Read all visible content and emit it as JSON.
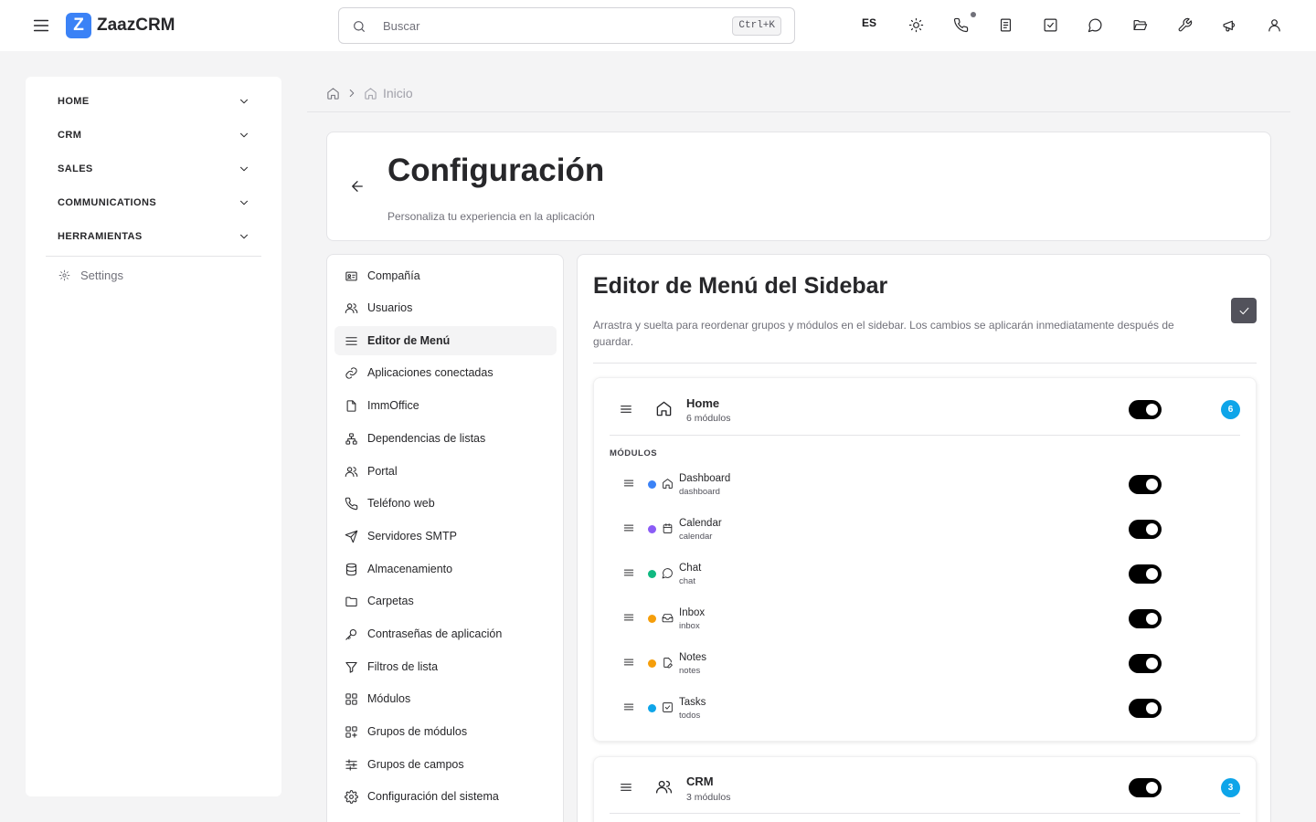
{
  "app": {
    "logo_letter": "Z",
    "name": "ZaazCRM"
  },
  "topbar": {
    "search_placeholder": "Buscar",
    "search_shortcut": "Ctrl+K",
    "language": "ES",
    "icons": [
      "sun-icon",
      "phone-icon",
      "notebook-icon",
      "check-square-icon",
      "chat-icon",
      "folder-icon",
      "wrench-icon",
      "megaphone-icon",
      "user-icon"
    ]
  },
  "leftnav": {
    "groups": [
      "HOME",
      "CRM",
      "SALES",
      "COMMUNICATIONS",
      "HERRAMIENTAS"
    ],
    "settings_label": "Settings"
  },
  "breadcrumb": {
    "current": "Inicio"
  },
  "header": {
    "title": "Configuración",
    "subtitle": "Personaliza tu experiencia en la aplicación"
  },
  "settings_nav": {
    "items": [
      {
        "label": "Compañía",
        "icon": "id-card-icon"
      },
      {
        "label": "Usuarios",
        "icon": "users-icon"
      },
      {
        "label": "Editor de Menú",
        "icon": "menu-icon",
        "active": true
      },
      {
        "label": "Aplicaciones conectadas",
        "icon": "link-icon"
      },
      {
        "label": "ImmOffice",
        "icon": "file-icon"
      },
      {
        "label": "Dependencias de listas",
        "icon": "network-icon"
      },
      {
        "label": "Portal",
        "icon": "users-icon"
      },
      {
        "label": "Teléfono web",
        "icon": "phone-icon"
      },
      {
        "label": "Servidores SMTP",
        "icon": "send-icon"
      },
      {
        "label": "Almacenamiento",
        "icon": "database-icon"
      },
      {
        "label": "Carpetas",
        "icon": "folder-icon"
      },
      {
        "label": "Contraseñas de aplicación",
        "icon": "key-icon"
      },
      {
        "label": "Filtros de lista",
        "icon": "filter-icon"
      },
      {
        "label": "Módulos",
        "icon": "grid-icon"
      },
      {
        "label": "Grupos de módulos",
        "icon": "grid-plus-icon"
      },
      {
        "label": "Grupos de campos",
        "icon": "sliders-icon"
      },
      {
        "label": "Configuración del sistema",
        "icon": "gear-icon"
      }
    ]
  },
  "editor": {
    "title": "Editor de Menú del Sidebar",
    "description": "Arrastra y suelta para reordenar grupos y módulos en el sidebar. Los cambios se aplicarán inmediatamente después de guardar.",
    "modules_label": "MÓDULOS",
    "groups": [
      {
        "name": "Home",
        "count_label": "6 módulos",
        "badge": "6",
        "enabled": true,
        "modules": [
          {
            "name": "Dashboard",
            "key": "dashboard",
            "color": "#3b82f6",
            "icon": "home-icon",
            "enabled": true
          },
          {
            "name": "Calendar",
            "key": "calendar",
            "color": "#8b5cf6",
            "icon": "calendar-icon",
            "enabled": true
          },
          {
            "name": "Chat",
            "key": "chat",
            "color": "#10b981",
            "icon": "chat-icon",
            "enabled": true
          },
          {
            "name": "Inbox",
            "key": "inbox",
            "color": "#f59e0b",
            "icon": "inbox-icon",
            "enabled": true
          },
          {
            "name": "Notes",
            "key": "notes",
            "color": "#f59e0b",
            "icon": "note-icon",
            "enabled": true
          },
          {
            "name": "Tasks",
            "key": "todos",
            "color": "#0ea5e9",
            "icon": "check-square-icon",
            "enabled": true
          }
        ]
      },
      {
        "name": "CRM",
        "count_label": "3 módulos",
        "badge": "3",
        "enabled": true,
        "modules": []
      }
    ]
  }
}
